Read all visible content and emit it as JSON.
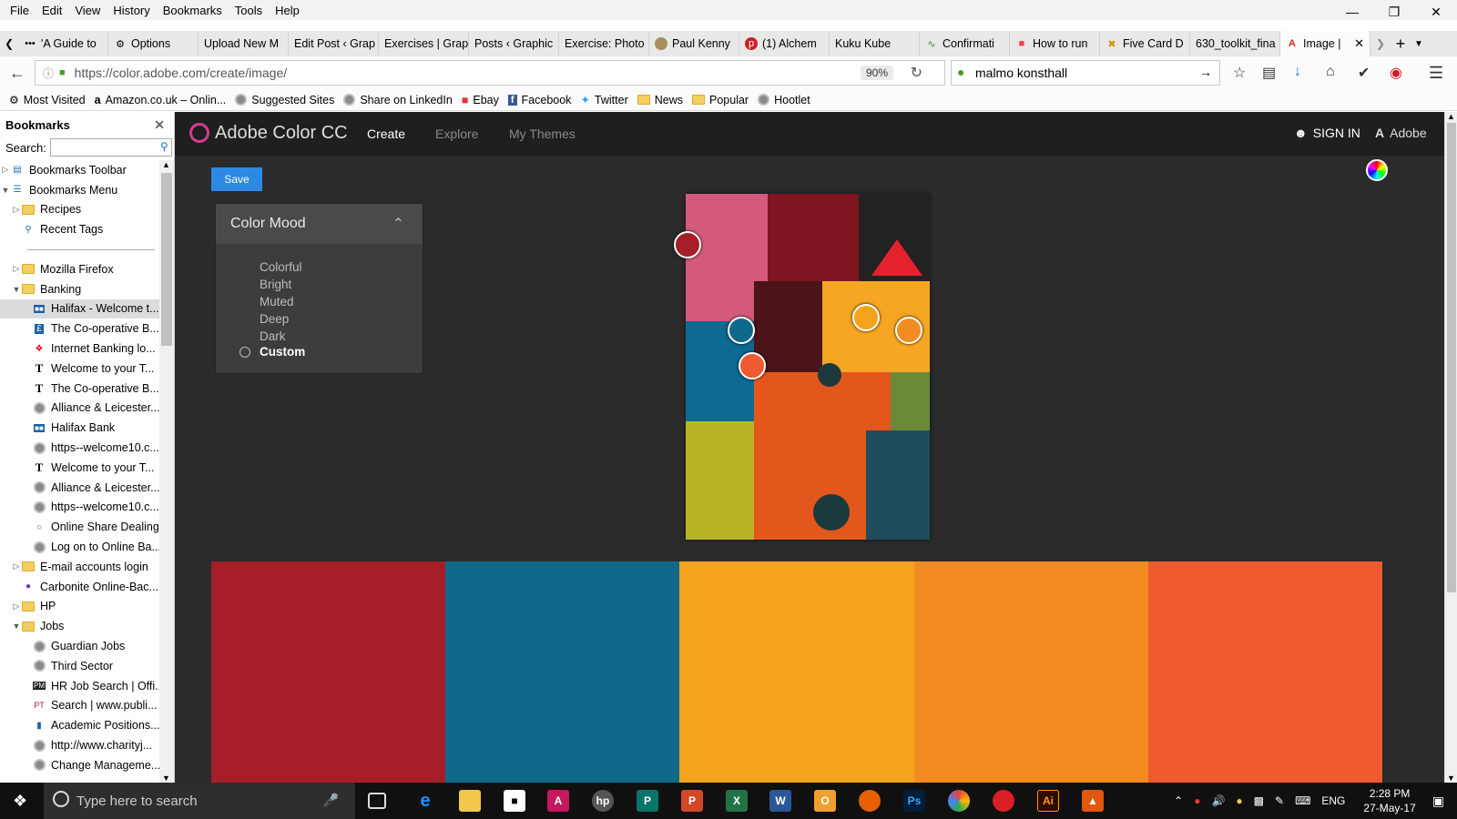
{
  "menu": [
    "File",
    "Edit",
    "View",
    "History",
    "Bookmarks",
    "Tools",
    "Help"
  ],
  "tabs": [
    "'A Guide to",
    "Options",
    "Upload New M",
    "Edit Post ‹ Grap",
    "Exercises | Grap",
    "Posts ‹ Graphic",
    "Exercise: Photo",
    "Paul Kenny",
    "(1) Alchem",
    "Kuku Kube",
    "Confirmati",
    "How to run",
    "Five Card D",
    "630_toolkit_fina",
    "Image |"
  ],
  "url": "https://color.adobe.com/create/image/",
  "zoom": "90%",
  "search_value": "malmo konsthall",
  "bookmarks_bar": [
    "Most Visited",
    "Amazon.co.uk – Onlin...",
    "Suggested Sites",
    "Share on LinkedIn",
    "Ebay",
    "Facebook",
    "Twitter",
    "News",
    "Popular",
    "Hootlet"
  ],
  "sidebar": {
    "title": "Bookmarks",
    "search_label": "Search:",
    "items": [
      {
        "label": "Bookmarks Toolbar",
        "icon": "toolbar"
      },
      {
        "label": "Bookmarks Menu",
        "icon": "menu"
      },
      {
        "label": "Recipes",
        "icon": "folder"
      },
      {
        "label": "Recent Tags",
        "icon": "tag"
      },
      {
        "label": "",
        "icon": "separator"
      },
      {
        "label": "Mozilla Firefox",
        "icon": "folder"
      },
      {
        "label": "Banking",
        "icon": "folder"
      },
      {
        "label": "Halifax - Welcome t...",
        "icon": "halifax"
      },
      {
        "label": "The Co-operative B...",
        "icon": "pound"
      },
      {
        "label": "Internet Banking lo...",
        "icon": "hsbc"
      },
      {
        "label": "Welcome to your T...",
        "icon": "T"
      },
      {
        "label": "The Co-operative B...",
        "icon": "T"
      },
      {
        "label": "Alliance & Leicester...",
        "icon": "globe"
      },
      {
        "label": "Halifax Bank",
        "icon": "halifax"
      },
      {
        "label": "https--welcome10.c...",
        "icon": "globe"
      },
      {
        "label": "Welcome to your T...",
        "icon": "T"
      },
      {
        "label": "Alliance & Leicester...",
        "icon": "globe"
      },
      {
        "label": "https--welcome10.c...",
        "icon": "globe"
      },
      {
        "label": "Online Share Dealing",
        "icon": "share"
      },
      {
        "label": "Log on to Online Ba...",
        "icon": "globe"
      },
      {
        "label": "E-mail accounts login",
        "icon": "folder"
      },
      {
        "label": "Carbonite Online-Bac...",
        "icon": "carbonite"
      },
      {
        "label": "HP",
        "icon": "folder"
      },
      {
        "label": "Jobs",
        "icon": "folder"
      },
      {
        "label": "Guardian Jobs",
        "icon": "globe"
      },
      {
        "label": "Third Sector",
        "icon": "globe"
      },
      {
        "label": "HR Job Search | Offi...",
        "icon": "PM"
      },
      {
        "label": "Search | www.publi...",
        "icon": "PT"
      },
      {
        "label": "Academic Positions...",
        "icon": "bar"
      },
      {
        "label": "http://www.charityj...",
        "icon": "globe"
      },
      {
        "label": "Change Manageme...",
        "icon": "globe"
      }
    ]
  },
  "app": {
    "name": "Adobe Color CC",
    "nav": [
      "Create",
      "Explore",
      "My Themes"
    ],
    "sign_in": "SIGN IN",
    "adobe": "Adobe",
    "save": "Save",
    "mood_title": "Color Mood",
    "moods": [
      "Colorful",
      "Bright",
      "Muted",
      "Deep",
      "Dark",
      "Custom"
    ],
    "selected_mood": "Custom",
    "swatches": [
      "#a61e27",
      "#0f6a8a",
      "#f4a31c",
      "#f28c22",
      "#ef5a2e"
    ]
  },
  "taskbar": {
    "search_placeholder": "Type here to search",
    "lang": "ENG",
    "time": "2:28 PM",
    "date": "27-May-17"
  }
}
